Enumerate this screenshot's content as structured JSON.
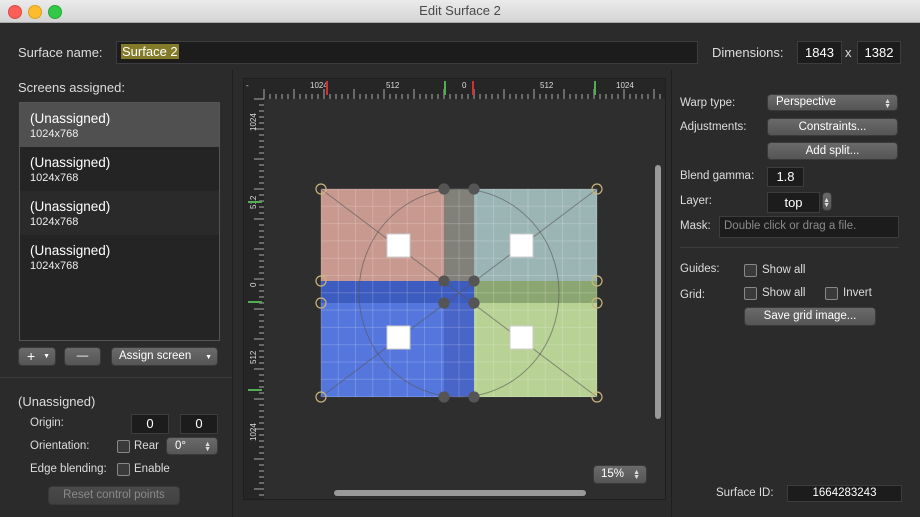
{
  "window": {
    "title": "Edit Surface 2"
  },
  "surface": {
    "name_label": "Surface name:",
    "name_value": "Surface 2",
    "dimensions_label": "Dimensions:",
    "width": "1843",
    "x": "x",
    "height": "1382"
  },
  "screens": {
    "label": "Screens assigned:",
    "items": [
      {
        "name": "(Unassigned)",
        "res": "1024x768"
      },
      {
        "name": "(Unassigned)",
        "res": "1024x768"
      },
      {
        "name": "(Unassigned)",
        "res": "1024x768"
      },
      {
        "name": "(Unassigned)",
        "res": "1024x768"
      }
    ],
    "add": "+",
    "remove": "—",
    "assign": "Assign screen"
  },
  "selected": {
    "title": "(Unassigned)",
    "origin_label": "Origin:",
    "origin_x": "0",
    "origin_y": "0",
    "orientation_label": "Orientation:",
    "rear_label": "Rear",
    "rotation": "0°",
    "edge_label": "Edge blending:",
    "enable_label": "Enable",
    "reset": "Reset control points"
  },
  "ruler": {
    "top": [
      "-",
      "1024",
      "512",
      "0",
      "512",
      "1024"
    ],
    "left": [
      "1024",
      "512",
      "0",
      "512",
      "1024"
    ]
  },
  "zoom": "15%",
  "props": {
    "warp_label": "Warp type:",
    "warp_value": "Perspective",
    "adjust_label": "Adjustments:",
    "constraints": "Constraints...",
    "add_split": "Add split...",
    "blend_label": "Blend gamma:",
    "blend_value": "1.8",
    "layer_label": "Layer:",
    "layer_value": "top",
    "mask_label": "Mask:",
    "mask_placeholder": "Double click or drag a file.",
    "guides_label": "Guides:",
    "guides_show": "Show all",
    "grid_label": "Grid:",
    "grid_show": "Show all",
    "grid_invert": "Invert",
    "save_grid": "Save grid image...",
    "id_label": "Surface ID:",
    "id_value": "1664283243"
  },
  "colors": {
    "q1": "#d9a59a",
    "q2": "#a7c4c4",
    "q3": "#5a7ff0",
    "q4": "#c8e3a0"
  }
}
